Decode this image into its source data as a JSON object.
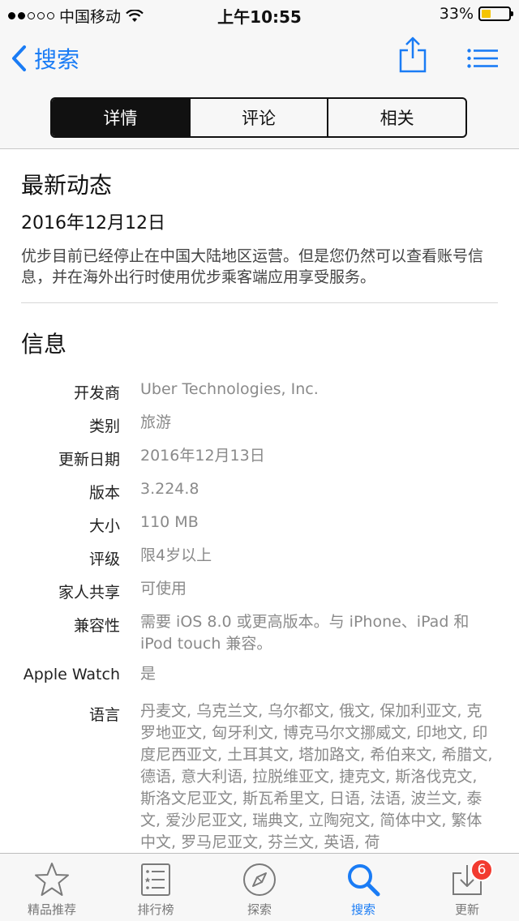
{
  "status_bar": {
    "carrier": "中国移动",
    "time": "上午10:55",
    "battery": "33%",
    "battery_level": 0.33,
    "signal_bars": 2,
    "wifi_icon": "wifi-icon"
  },
  "nav": {
    "back_label": "搜索",
    "share_icon": "share-icon",
    "menu_icon": "list-icon",
    "accent": "#1a7cf5"
  },
  "segments": [
    {
      "label": "详情",
      "active": true
    },
    {
      "label": "评论",
      "active": false
    },
    {
      "label": "相关",
      "active": false
    }
  ],
  "whats_new": {
    "heading": "最新动态",
    "date": "2016年12月12日",
    "body": "优步目前已经停止在中国大陆地区运营。但是您仍然可以查看账号信息，并在海外出行时使用优步乘客端应用享受服务。"
  },
  "info": {
    "heading": "信息",
    "rows": [
      {
        "label": "开发商",
        "value": "Uber Technologies, Inc."
      },
      {
        "label": "类别",
        "value": "旅游"
      },
      {
        "label": "更新日期",
        "value": "2016年12月13日"
      },
      {
        "label": "版本",
        "value": "3.224.8"
      },
      {
        "label": "大小",
        "value": "110 MB"
      },
      {
        "label": "评级",
        "value": "限4岁以上"
      },
      {
        "label": "家人共享",
        "value": "可使用"
      },
      {
        "label": "兼容性",
        "value": "需要 iOS 8.0 或更高版本。与 iPhone、iPad 和 iPod touch 兼容。"
      },
      {
        "label": "Apple Watch",
        "value": "是"
      },
      {
        "label": "语言",
        "value": "丹麦文, 乌克兰文, 乌尔都文, 俄文, 保加利亚文, 克罗地亚文, 匈牙利文, 博克马尔文挪威文, 印地文, 印度尼西亚文, 土耳其文, 塔加路文, 希伯来文, 希腊文, 德语, 意大利语, 拉脱维亚文, 捷克文, 斯洛伐克文, 斯洛文尼亚文, 斯瓦希里文, 日语, 法语, 波兰文, 泰文, 爱沙尼亚文, 瑞典文, 立陶宛文, 简体中文, 繁体中文, 罗马尼亚文, 芬兰文, 英语, 荷"
      }
    ]
  },
  "tabbar": {
    "tabs": [
      {
        "label": "精品推荐",
        "icon": "star-icon",
        "active": false
      },
      {
        "label": "排行榜",
        "icon": "ranking-list-icon",
        "active": false
      },
      {
        "label": "探索",
        "icon": "compass-icon",
        "active": false
      },
      {
        "label": "搜索",
        "icon": "search-icon",
        "active": true
      },
      {
        "label": "更新",
        "icon": "download-icon",
        "active": false,
        "badge": "6"
      }
    ]
  }
}
